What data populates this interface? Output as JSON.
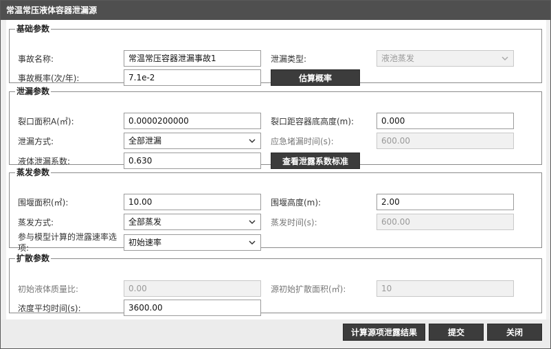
{
  "window": {
    "title": "常温常压液体容器泄漏源"
  },
  "basic": {
    "legend": "基础参数",
    "accident_name_label": "事故名称:",
    "accident_name_value": "常温常压容器泄漏事故1",
    "leak_type_label": "泄漏类型:",
    "leak_type_value": "液池蒸发",
    "probability_label": "事故概率(次/年):",
    "probability_value": "7.1e-2",
    "estimate_button": "估算概率"
  },
  "leak": {
    "legend": "泄漏参数",
    "crack_area_label": "裂口面积A(㎡):",
    "crack_area_value": "0.0000200000",
    "crack_height_label": "裂口距容器底高度(m):",
    "crack_height_value": "0.000",
    "leak_mode_label": "泄漏方式:",
    "leak_mode_value": "全部泄漏",
    "plug_time_label": "应急堵漏时间(s):",
    "plug_time_value": "600.00",
    "coef_label": "液体泄漏系数:",
    "coef_value": "0.630",
    "coef_button": "查看泄露系数标准"
  },
  "evap": {
    "legend": "蒸发参数",
    "dike_area_label": "围堰面积(㎡):",
    "dike_area_value": "10.00",
    "dike_height_label": "围堰高度(m):",
    "dike_height_value": "2.00",
    "evap_mode_label": "蒸发方式:",
    "evap_mode_value": "全部蒸发",
    "evap_time_label": "蒸发时间(s):",
    "evap_time_value": "600.00",
    "rate_option_label_line1": "参与模型计算的泄露速率选",
    "rate_option_label_line2": "项:",
    "rate_option_value": "初始速率"
  },
  "disp": {
    "legend": "扩散参数",
    "mass_ratio_label": "初始液体质量比:",
    "mass_ratio_value": "0.00",
    "source_area_label": "源初始扩散面积(㎡):",
    "source_area_value": "10",
    "avg_time_label": "浓度平均时间(s):",
    "avg_time_value": "3600.00"
  },
  "footer": {
    "calc_button": "计算源项泄露结果",
    "submit_button": "提交",
    "close_button": "关闭"
  },
  "icons": {
    "dropdown": "chevron-down-icon"
  }
}
